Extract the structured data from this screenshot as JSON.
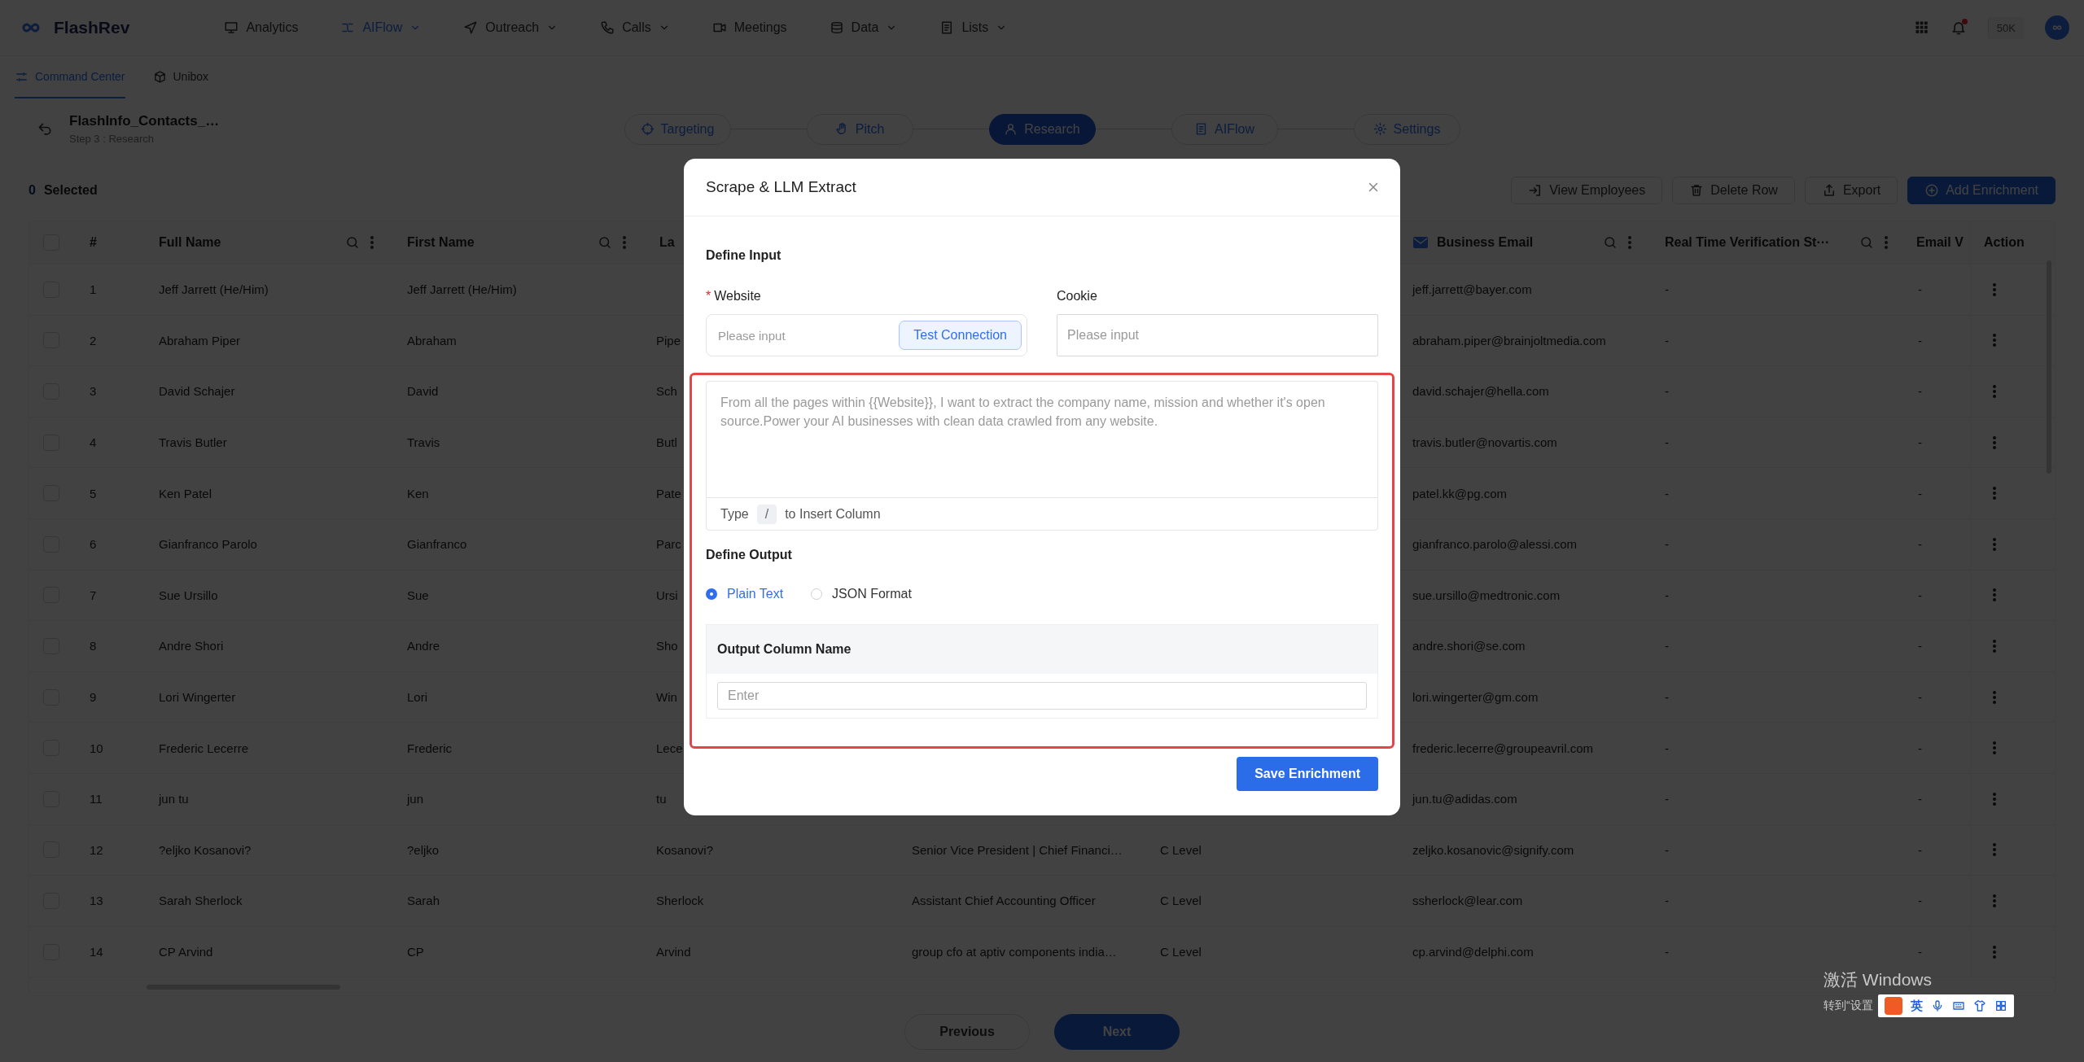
{
  "nav": {
    "logo": "FlashRev",
    "items": [
      {
        "label": "Analytics",
        "caret": false,
        "selected": false
      },
      {
        "label": "AIFlow",
        "caret": true,
        "selected": true
      },
      {
        "label": "Outreach",
        "caret": true,
        "selected": false
      },
      {
        "label": "Calls",
        "caret": true,
        "selected": false
      },
      {
        "label": "Meetings",
        "caret": false,
        "selected": false
      },
      {
        "label": "Data",
        "caret": true,
        "selected": false
      },
      {
        "label": "Lists",
        "caret": true,
        "selected": false
      }
    ],
    "notifications_unread": true,
    "credits": "50K"
  },
  "subnav": [
    {
      "label": "Command Center",
      "selected": true
    },
    {
      "label": "Unibox",
      "selected": false
    }
  ],
  "header": {
    "title": "FlashInfo_Contacts_…",
    "subtitle": "Step 3 : Research"
  },
  "steps": [
    {
      "label": "Targeting",
      "selected": false
    },
    {
      "label": "Pitch",
      "selected": false
    },
    {
      "label": "Research",
      "selected": true
    },
    {
      "label": "AIFlow",
      "selected": false
    },
    {
      "label": "Settings",
      "selected": false
    }
  ],
  "toolbar": {
    "count": "0",
    "count_label": "Selected",
    "buttons": [
      {
        "label": "View Employees",
        "kind": "default"
      },
      {
        "label": "Delete Row",
        "kind": "default"
      },
      {
        "label": "Export",
        "kind": "default"
      },
      {
        "label": "Add Enrichment",
        "kind": "primary"
      }
    ]
  },
  "table": {
    "all_checked": false,
    "columns": [
      {
        "label": "#",
        "tools": false
      },
      {
        "label": "Full Name",
        "tools": true
      },
      {
        "label": "First Name",
        "tools": true
      },
      {
        "label": "La"
      },
      {
        "label": "Business Email",
        "tools": true
      },
      {
        "label": "Real Time Verification St···",
        "tools": true
      },
      {
        "label": "Email V"
      },
      {
        "label": "Action",
        "tools": false
      }
    ],
    "rows": [
      {
        "n": "1",
        "full_name": "Jeff Jarrett (He/Him)",
        "first_name": "Jeff Jarrett (He/Him)",
        "email": "jeff.jarrett@bayer.com",
        "verification": "-",
        "email_v": "-",
        "checked": false
      },
      {
        "n": "2",
        "full_name": "Abraham Piper",
        "first_name": "Abraham",
        "last_name": "Pipe",
        "email": "abraham.piper@brainjoltmedia.com",
        "verification": "-",
        "email_v": "-",
        "checked": false
      },
      {
        "n": "3",
        "full_name": "David Schajer",
        "first_name": "David",
        "last_name": "Sch",
        "email": "david.schajer@hella.com",
        "verification": "-",
        "email_v": "-",
        "checked": false
      },
      {
        "n": "4",
        "full_name": "Travis Butler",
        "first_name": "Travis",
        "last_name": "Butl",
        "email": "travis.butler@novartis.com",
        "verification": "-",
        "email_v": "-",
        "checked": false
      },
      {
        "n": "5",
        "full_name": "Ken Patel",
        "first_name": "Ken",
        "last_name": "Pate",
        "email": "patel.kk@pg.com",
        "verification": "-",
        "email_v": "-",
        "checked": false
      },
      {
        "n": "6",
        "full_name": "Gianfranco Parolo",
        "first_name": "Gianfranco",
        "last_name": "Parc",
        "email": "gianfranco.parolo@alessi.com",
        "verification": "-",
        "email_v": "-",
        "checked": false
      },
      {
        "n": "7",
        "full_name": "Sue Ursillo",
        "first_name": "Sue",
        "last_name": "Ursi",
        "email": "sue.ursillo@medtronic.com",
        "verification": "-",
        "email_v": "-",
        "checked": false
      },
      {
        "n": "8",
        "full_name": "Andre Shori",
        "first_name": "Andre",
        "last_name": "Sho",
        "email": "andre.shori@se.com",
        "verification": "-",
        "email_v": "-",
        "checked": false
      },
      {
        "n": "9",
        "full_name": "Lori Wingerter",
        "first_name": "Lori",
        "last_name": "Win",
        "email": "lori.wingerter@gm.com",
        "verification": "-",
        "email_v": "-",
        "checked": false
      },
      {
        "n": "10",
        "full_name": "Frederic Lecerre",
        "first_name": "Frederic",
        "last_name": "Lece",
        "email": "frederic.lecerre@groupeavril.com",
        "verification": "-",
        "email_v": "-",
        "checked": false
      },
      {
        "n": "11",
        "full_name": "jun tu",
        "first_name": "jun",
        "last_name": "tu",
        "email": "jun.tu@adidas.com",
        "verification": "-",
        "email_v": "-",
        "checked": false
      },
      {
        "n": "12",
        "full_name": "?eljko Kosanovi?",
        "first_name": "?eljko",
        "last_name": "Kosanovi?",
        "title": "Senior Vice President | Chief Financi…",
        "level": "C Level",
        "email": "zeljko.kosanovic@signify.com",
        "verification": "-",
        "email_v": "-",
        "checked": false
      },
      {
        "n": "13",
        "full_name": "Sarah Sherlock",
        "first_name": "Sarah",
        "last_name": "Sherlock",
        "title": "Assistant Chief Accounting Officer",
        "level": "C Level",
        "email": "ssherlock@lear.com",
        "verification": "-",
        "email_v": "-",
        "checked": false
      },
      {
        "n": "14",
        "full_name": "CP Arvind",
        "first_name": "CP",
        "last_name": "Arvind",
        "title": "group cfo at aptiv components india…",
        "level": "C Level",
        "email": "cp.arvind@delphi.com",
        "verification": "-",
        "email_v": "-",
        "checked": false
      }
    ]
  },
  "pagination": [
    {
      "label": "Previous",
      "kind": "default"
    },
    {
      "label": "Next",
      "kind": "primary"
    }
  ],
  "modal": {
    "title": "Scrape & LLM Extract",
    "highlight": true,
    "input_heading": "Define Input",
    "website_label": "Website",
    "required_mark": "*",
    "website_placeholder": "Please input",
    "test_button": "Test Connection",
    "cookie_label": "Cookie",
    "cookie_placeholder": "Please input",
    "prompt_placeholder": "From all the pages within {{Website}}, I want to extract the company name, mission and whether it's open source.Power your AI businesses with clean data crawled from any website.",
    "hint_before": "Type",
    "hint_key": "/",
    "hint_after": "to Insert Column",
    "output_heading": "Define Output",
    "formats": [
      {
        "label": "Plain Text",
        "selected": true
      },
      {
        "label": "JSON Format",
        "selected": false
      }
    ],
    "column_heading": "Output Column Name",
    "column_placeholder": "Enter",
    "save_button": "Save Enrichment"
  },
  "os": {
    "activation_title": "激活 Windows",
    "activation_hint": "转到“设置",
    "ime_mode": "英"
  }
}
